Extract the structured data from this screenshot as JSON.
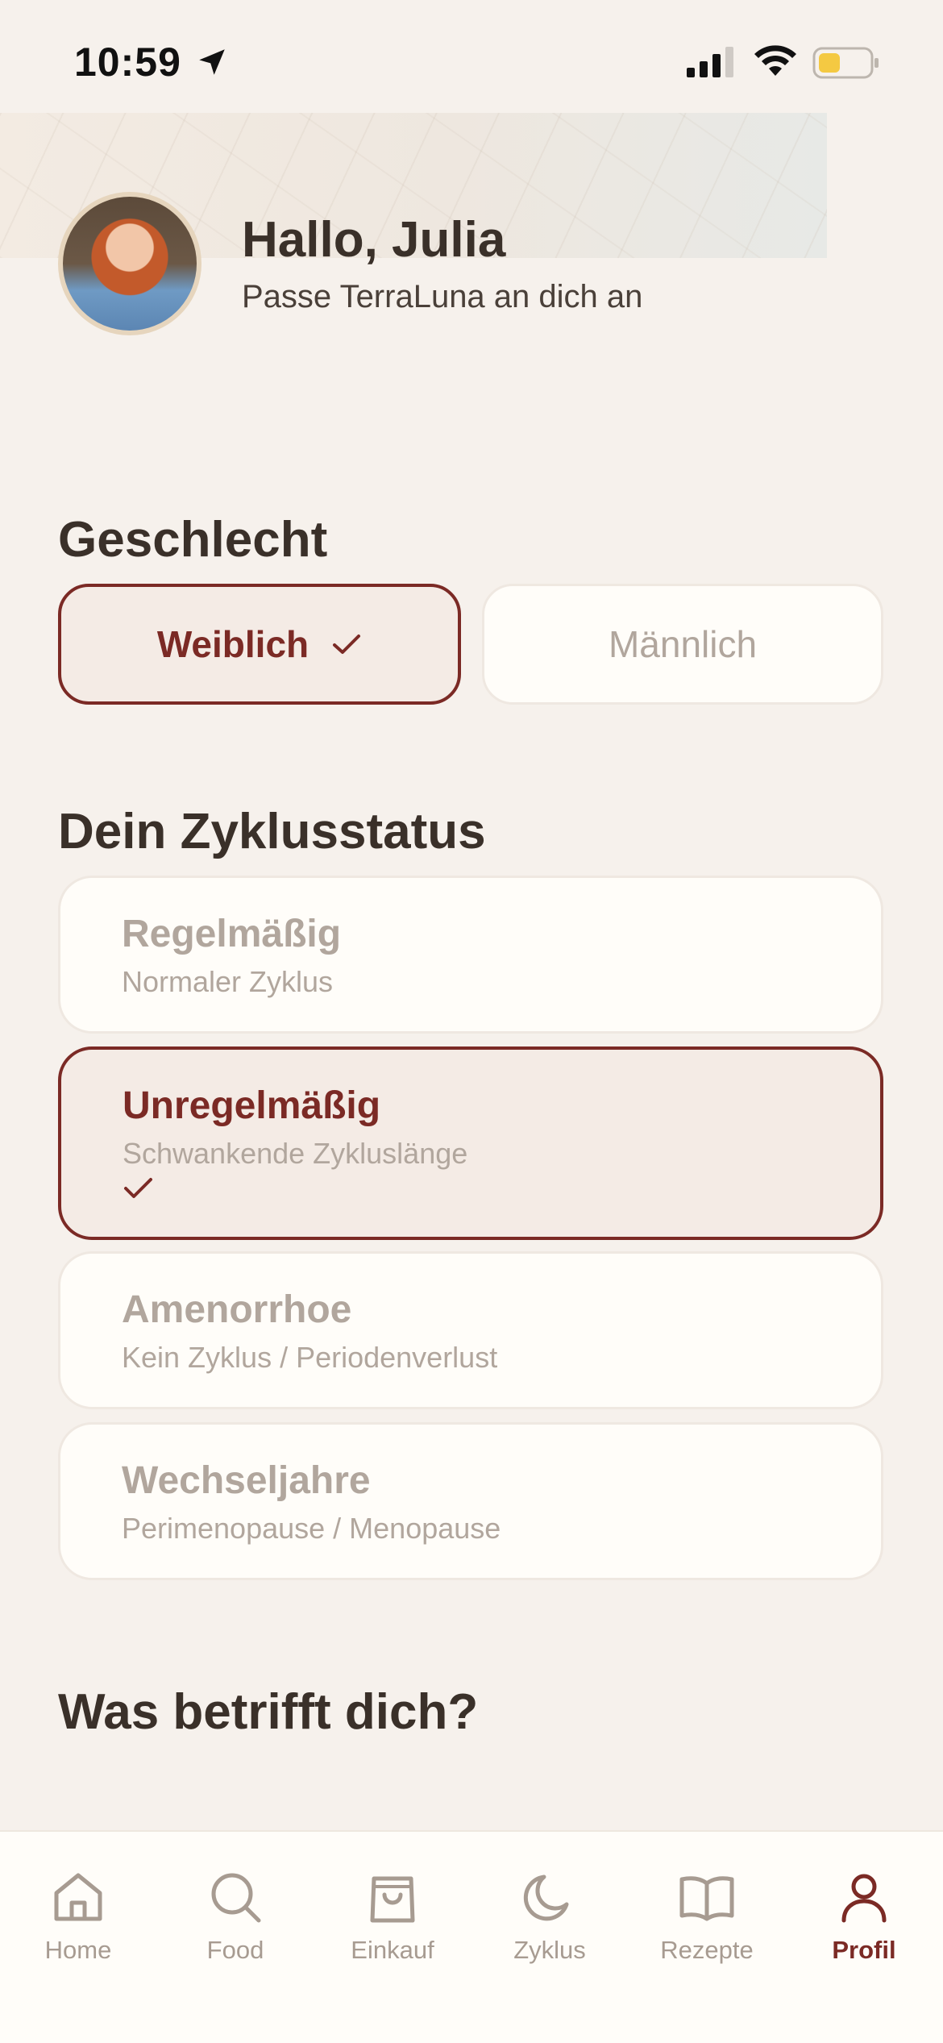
{
  "status_bar": {
    "time": "10:59"
  },
  "header": {
    "greeting": "Hallo, Julia",
    "subtitle": "Passe TerraLuna an dich an"
  },
  "gender": {
    "title": "Geschlecht",
    "options": [
      {
        "label": "Weiblich",
        "selected": true
      },
      {
        "label": "Männlich",
        "selected": false
      }
    ]
  },
  "cycle": {
    "title": "Dein Zyklusstatus",
    "options": [
      {
        "title": "Regelmäßig",
        "subtitle": "Normaler Zyklus",
        "selected": false
      },
      {
        "title": "Unregelmäßig",
        "subtitle": "Schwankende Zykluslänge",
        "selected": true
      },
      {
        "title": "Amenorrhoe",
        "subtitle": "Kein Zyklus / Periodenverlust",
        "selected": false
      },
      {
        "title": "Wechseljahre",
        "subtitle": "Perimenopause / Menopause",
        "selected": false
      }
    ]
  },
  "concerns": {
    "title": "Was betrifft dich?"
  },
  "tabbar": {
    "items": [
      {
        "label": "Home",
        "icon": "home-icon"
      },
      {
        "label": "Food",
        "icon": "search-icon"
      },
      {
        "label": "Einkauf",
        "icon": "shopping-bag-icon"
      },
      {
        "label": "Zyklus",
        "icon": "moon-icon"
      },
      {
        "label": "Rezepte",
        "icon": "book-icon"
      },
      {
        "label": "Profil",
        "icon": "user-icon",
        "active": true
      }
    ]
  },
  "colors": {
    "accent": "#7b2a25",
    "background": "#f6f1ec",
    "card": "#fffdf9",
    "muted_text": "#b1a69d"
  }
}
